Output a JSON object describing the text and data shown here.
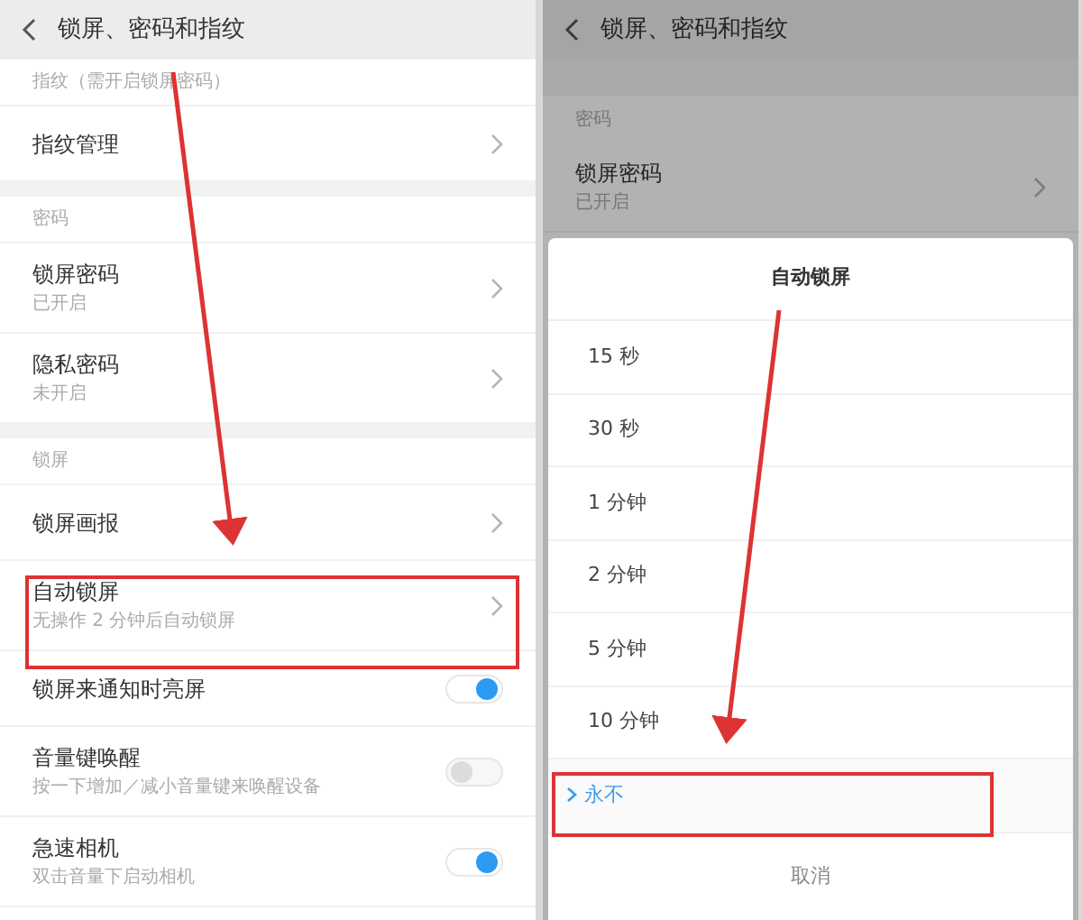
{
  "left_screen": {
    "title": "锁屏、密码和指纹",
    "sections": [
      {
        "label": "指纹（需开启锁屏密码）",
        "rows": [
          {
            "kind": "link",
            "title": "指纹管理"
          }
        ]
      },
      {
        "label": "密码",
        "rows": [
          {
            "kind": "link",
            "title": "锁屏密码",
            "subtitle": "已开启"
          },
          {
            "kind": "link",
            "title": "隐私密码",
            "subtitle": "未开启"
          }
        ]
      },
      {
        "label": "锁屏",
        "rows": [
          {
            "kind": "link",
            "title": "锁屏画报"
          },
          {
            "kind": "link",
            "title": "自动锁屏",
            "subtitle": "无操作 2 分钟后自动锁屏"
          },
          {
            "kind": "toggle",
            "title": "锁屏来通知时亮屏",
            "on": true
          },
          {
            "kind": "toggle",
            "title": "音量键唤醒",
            "subtitle": "按一下增加／减小音量键来唤醒设备",
            "on": false
          },
          {
            "kind": "toggle",
            "title": "急速相机",
            "subtitle": "双击音量下启动相机",
            "on": true
          }
        ]
      }
    ]
  },
  "right_screen": {
    "title": "锁屏、密码和指纹",
    "section_label": "密码",
    "row": {
      "title": "锁屏密码",
      "subtitle": "已开启"
    },
    "dialog": {
      "title": "自动锁屏",
      "options": [
        {
          "label": "15 秒",
          "selected": false
        },
        {
          "label": "30 秒",
          "selected": false
        },
        {
          "label": "1 分钟",
          "selected": false
        },
        {
          "label": "2 分钟",
          "selected": false
        },
        {
          "label": "5 分钟",
          "selected": false
        },
        {
          "label": "10 分钟",
          "selected": false
        },
        {
          "label": "永不",
          "selected": true
        }
      ],
      "cancel": "取消"
    }
  }
}
